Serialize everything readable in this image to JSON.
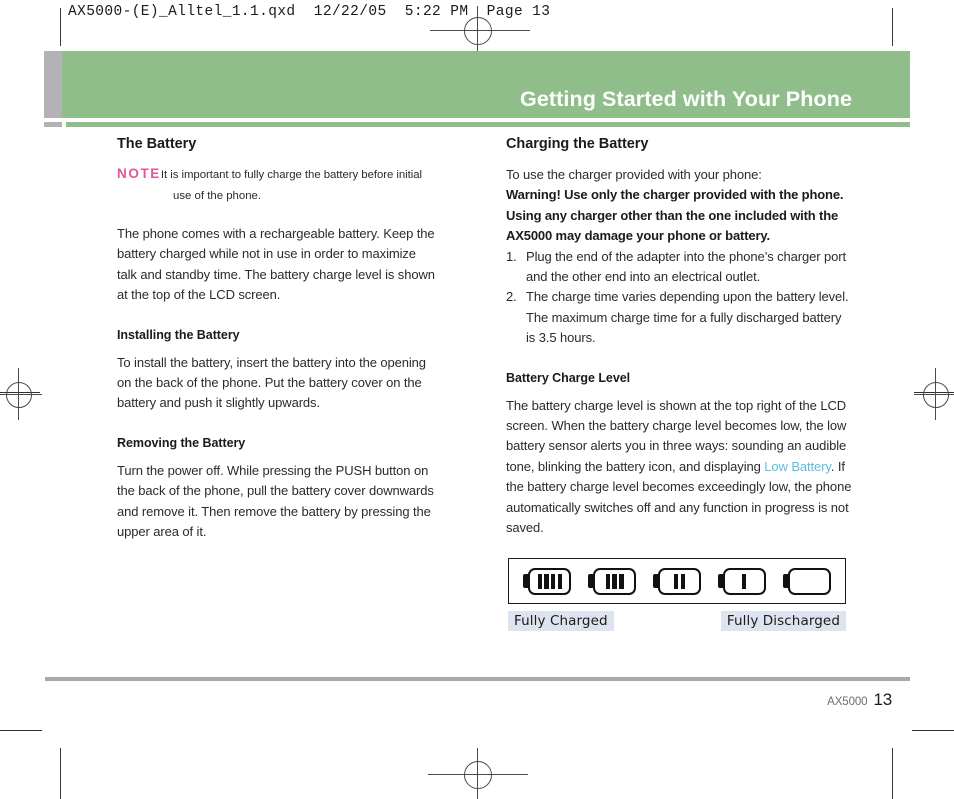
{
  "document": {
    "qxd_header": "AX5000-(E)_Alltel_1.1.qxd  12/22/05  5:22 PM  Page 13",
    "banner_title": "Getting Started with Your Phone",
    "colors": {
      "banner_green": "#8FBE8A",
      "tab_gray": "#B4B2B6",
      "note_pink": "#E2549C",
      "link_blue": "#5CBDE1",
      "label_bg": "#DDE3EF",
      "footer_rule": "#A8A8A8"
    }
  },
  "left_column": {
    "section_title": "The Battery",
    "note": {
      "tag": "NOTE",
      "line1": "It is important to fully charge the battery before initial",
      "line2": "use of the phone."
    },
    "intro_paragraph": "The phone comes with a rechargeable battery. Keep the battery charged while not in use in order to maximize talk and standby time. The battery charge level is shown at the top of the LCD screen.",
    "installing": {
      "heading": "Installing the Battery",
      "body": "To install the battery, insert the battery into the opening on the back of the phone. Put the battery cover on the battery and push it slightly upwards."
    },
    "removing": {
      "heading": "Removing the Battery",
      "body": "Turn the power off. While pressing the PUSH button on the back of the phone, pull the battery cover downwards and remove it. Then remove the battery by pressing the upper area of it."
    }
  },
  "right_column": {
    "section_title": "Charging the Battery",
    "intro_line": "To use the charger provided with your phone:",
    "warning": "Warning! Use only the charger provided with the phone. Using any charger other than the one included with the AX5000 may damage your phone or battery.",
    "steps": [
      {
        "num": "1.",
        "text": "Plug the end of the adapter into the phone’s charger port and the other end into an electrical outlet."
      },
      {
        "num": "2.",
        "text": "The charge time varies depending upon the battery level. The maximum charge time for a fully discharged battery is 3.5 hours."
      }
    ],
    "charge_level": {
      "heading": "Battery Charge Level",
      "text_before_link": "The battery charge level is shown at the top right of the LCD screen. When the battery charge level becomes low, the low battery sensor alerts you in three ways: sounding an audible tone, blinking the battery icon, and displaying ",
      "link_text": "Low Battery",
      "text_after_link": ". If the battery charge level becomes exceedingly low, the phone automatically switches off and any function in progress is not saved."
    },
    "battery_figure": {
      "bars": [
        4,
        3,
        2,
        1,
        0
      ],
      "label_left": "Fully Charged",
      "label_right": "Fully Discharged"
    }
  },
  "footer": {
    "model": "AX5000",
    "page_number": "13"
  }
}
